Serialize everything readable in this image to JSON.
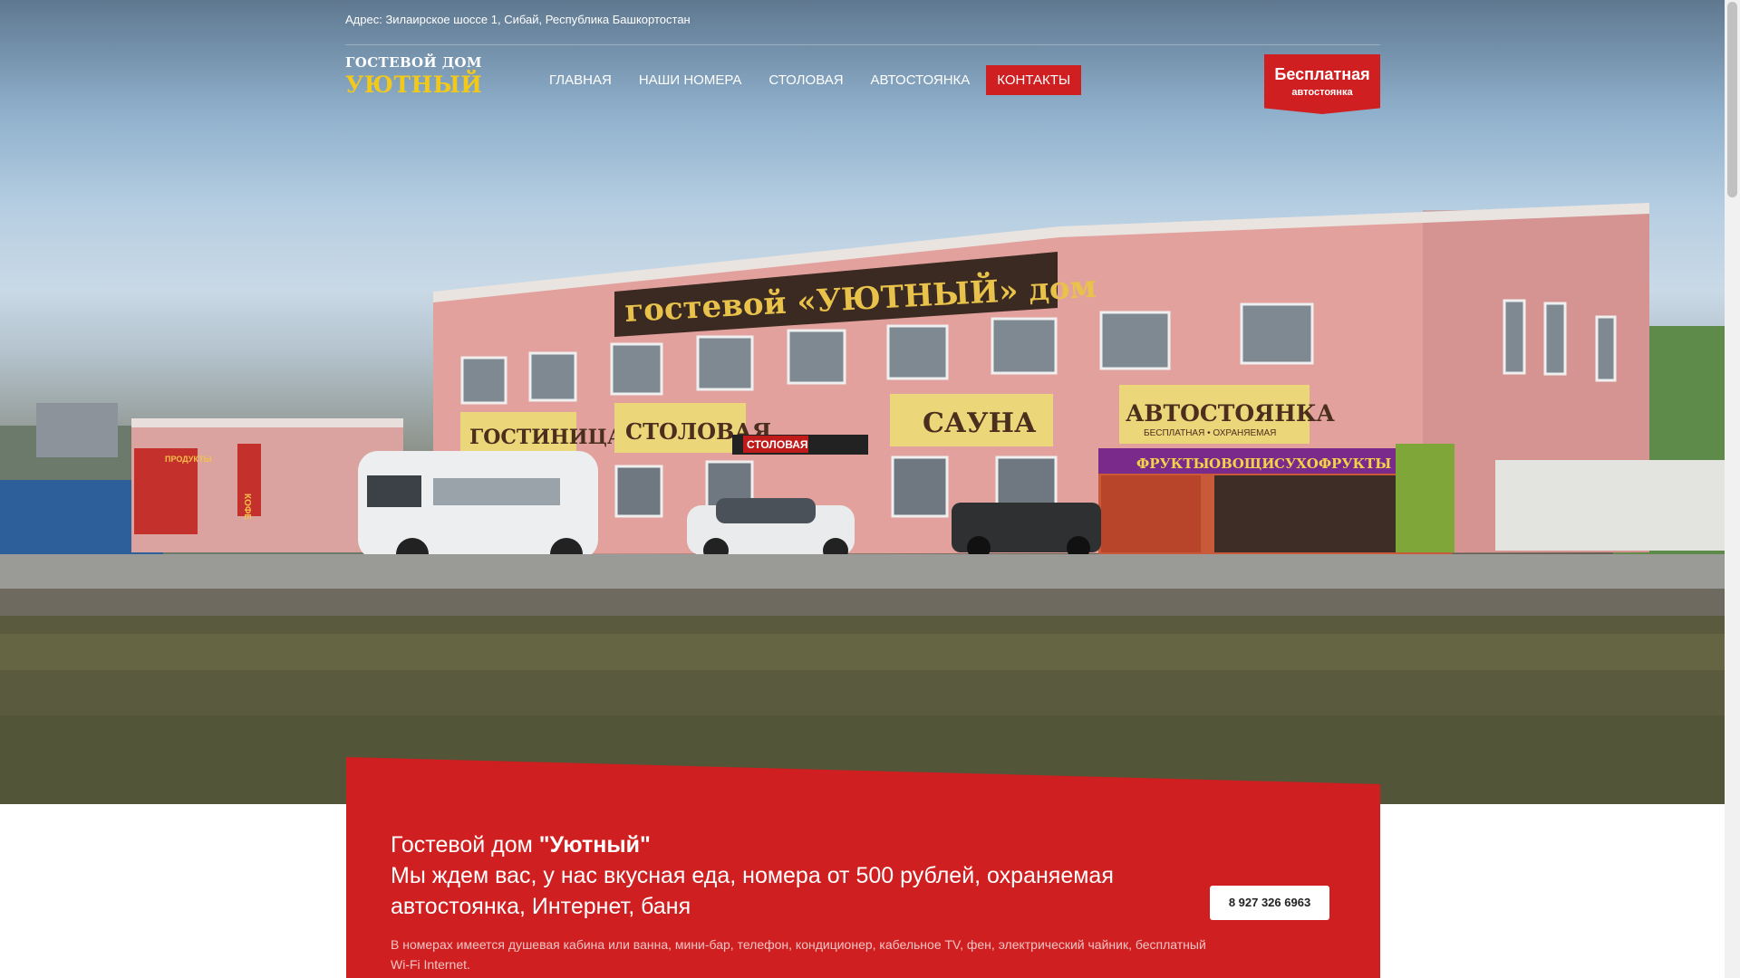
{
  "header": {
    "address": "Адрес: Зилаирское шоссе 1, Сибай, Республика Башкортостан",
    "logo_small": "ГОСТЕВОЙ ДОМ",
    "logo_big": "УЮТНЫЙ"
  },
  "nav": {
    "items": [
      {
        "label": "ГЛАВНАЯ",
        "active": false
      },
      {
        "label": "НАШИ НОМЕРА",
        "active": false
      },
      {
        "label": "СТОЛОВАЯ",
        "active": false
      },
      {
        "label": "АВТОСТОЯНКА",
        "active": false
      },
      {
        "label": "КОНТАКТЫ",
        "active": true
      }
    ]
  },
  "badge": {
    "title": "Бесплатная",
    "subtitle": "автостоянка"
  },
  "hero_photo": {
    "sign_main": "гостевой «УЮТНЫЙ» дом",
    "sign_hotel": "ГОСТИНИЦА",
    "sign_canteen": "СТОЛОВАЯ",
    "sign_canteen_small": "СТОЛОВАЯ",
    "sign_sauna": "САУНА",
    "sign_parking": "АВТОСТОЯНКА",
    "sign_parking_sub": "БЕСПЛАТНАЯ • ОХРАНЯЕМАЯ",
    "sign_fruits": "ФРУКТЫ",
    "sign_vegetables": "ОВОЩИ",
    "sign_dried": "СУХОФРУКТЫ",
    "sign_coffee": "КОФЕ",
    "sign_products": "ПРОДУКТЫ"
  },
  "intro": {
    "title_prefix": "Гостевой дом ",
    "title_name": "\"Уютный\"",
    "subtitle": "Мы ждем вас, у нас вкусная еда, номера от 500 рублей, охраняемая автостоянка, Интернет, баня",
    "description": "В номерах имеется душевая кабина или ванна, мини-бар, телефон, кондиционер, кабельное TV, фен, электрический чайник, бесплатный Wi-Fi Internet.",
    "phone": "8 927 326 6963"
  },
  "colors": {
    "accent": "#cf1f20",
    "logo_yellow": "#f2c91a"
  }
}
